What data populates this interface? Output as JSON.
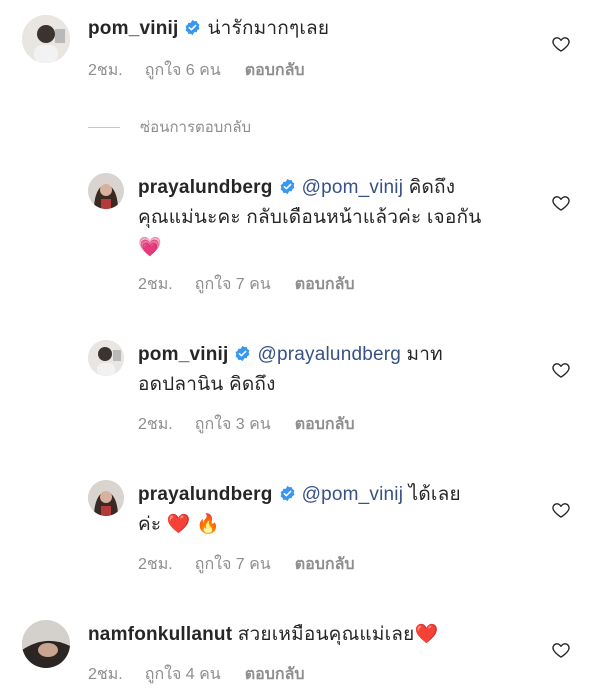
{
  "comments": [
    {
      "username": "pom_vinij",
      "verified": true,
      "text": "น่ารักมากๆเลย",
      "time": "2ชม.",
      "likes": "ถูกใจ 6 คน",
      "reply": "ตอบกลับ"
    },
    {
      "username": "prayalundberg",
      "verified": true,
      "mention": "@pom_vinij",
      "text_line1": "คิดถึง",
      "text_line2": "คุณแม่นะคะ กลับเดือนหน้าแล้วค่ะ เจอกัน",
      "emoji": "💗",
      "time": "2ชม.",
      "likes": "ถูกใจ 7 คน",
      "reply": "ตอบกลับ"
    },
    {
      "username": "pom_vinij",
      "verified": true,
      "mention": "@prayalundberg",
      "text_line1": "มาท",
      "text_line2": "อดปลานิน คิดถึง",
      "time": "2ชม.",
      "likes": "ถูกใจ 3 คน",
      "reply": "ตอบกลับ"
    },
    {
      "username": "prayalundberg",
      "verified": true,
      "mention": "@pom_vinij",
      "text_line1": "ได้เลย",
      "text_line2": "ค่ะ",
      "emoji": "❤️ 🔥",
      "time": "2ชม.",
      "likes": "ถูกใจ 7 คน",
      "reply": "ตอบกลับ"
    },
    {
      "username": "namfonkullanut",
      "verified": false,
      "text": "สวยเหมือนคุณแม่เลย",
      "emoji": "❤️",
      "time": "2ชม.",
      "likes": "ถูกใจ 4 คน",
      "reply": "ตอบกลับ"
    }
  ],
  "hide_replies_label": "ซ่อนการตอบกลับ",
  "colors": {
    "text": "#262626",
    "meta": "#8e8e8e",
    "mention": "#385185",
    "verified": "#3897f0"
  },
  "icons": {
    "verified": "verified-badge-icon",
    "like": "heart-outline-icon"
  }
}
